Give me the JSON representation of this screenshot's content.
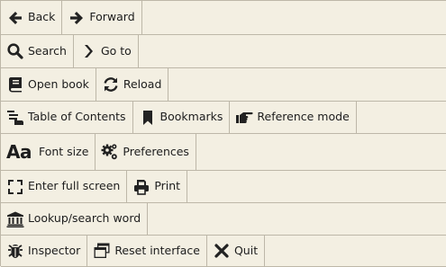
{
  "rows": [
    {
      "buttons": [
        {
          "label": "Back",
          "icon": "arrow-left-icon"
        },
        {
          "label": "Forward",
          "icon": "arrow-right-icon"
        }
      ]
    },
    {
      "buttons": [
        {
          "label": "Search",
          "icon": "search-icon"
        },
        {
          "label": "Go to",
          "icon": "chevron-right-icon"
        }
      ]
    },
    {
      "buttons": [
        {
          "label": "Open book",
          "icon": "book-icon"
        },
        {
          "label": "Reload",
          "icon": "reload-icon"
        }
      ]
    },
    {
      "buttons": [
        {
          "label": "Table of Contents",
          "icon": "toc-icon"
        },
        {
          "label": "Bookmarks",
          "icon": "bookmark-icon"
        },
        {
          "label": "Reference mode",
          "icon": "pointing-hand-icon"
        }
      ]
    },
    {
      "buttons": [
        {
          "label": "Font size",
          "icon": "font-size-icon",
          "glyph": "Aa"
        },
        {
          "label": "Preferences",
          "icon": "gears-icon"
        }
      ]
    },
    {
      "buttons": [
        {
          "label": "Enter full screen",
          "icon": "fullscreen-icon"
        },
        {
          "label": "Print",
          "icon": "printer-icon"
        }
      ]
    },
    {
      "buttons": [
        {
          "label": "Lookup/search word",
          "icon": "library-icon"
        }
      ]
    },
    {
      "buttons": [
        {
          "label": "Inspector",
          "icon": "bug-icon"
        },
        {
          "label": "Reset interface",
          "icon": "window-icon"
        },
        {
          "label": "Quit",
          "icon": "close-icon"
        }
      ]
    }
  ]
}
